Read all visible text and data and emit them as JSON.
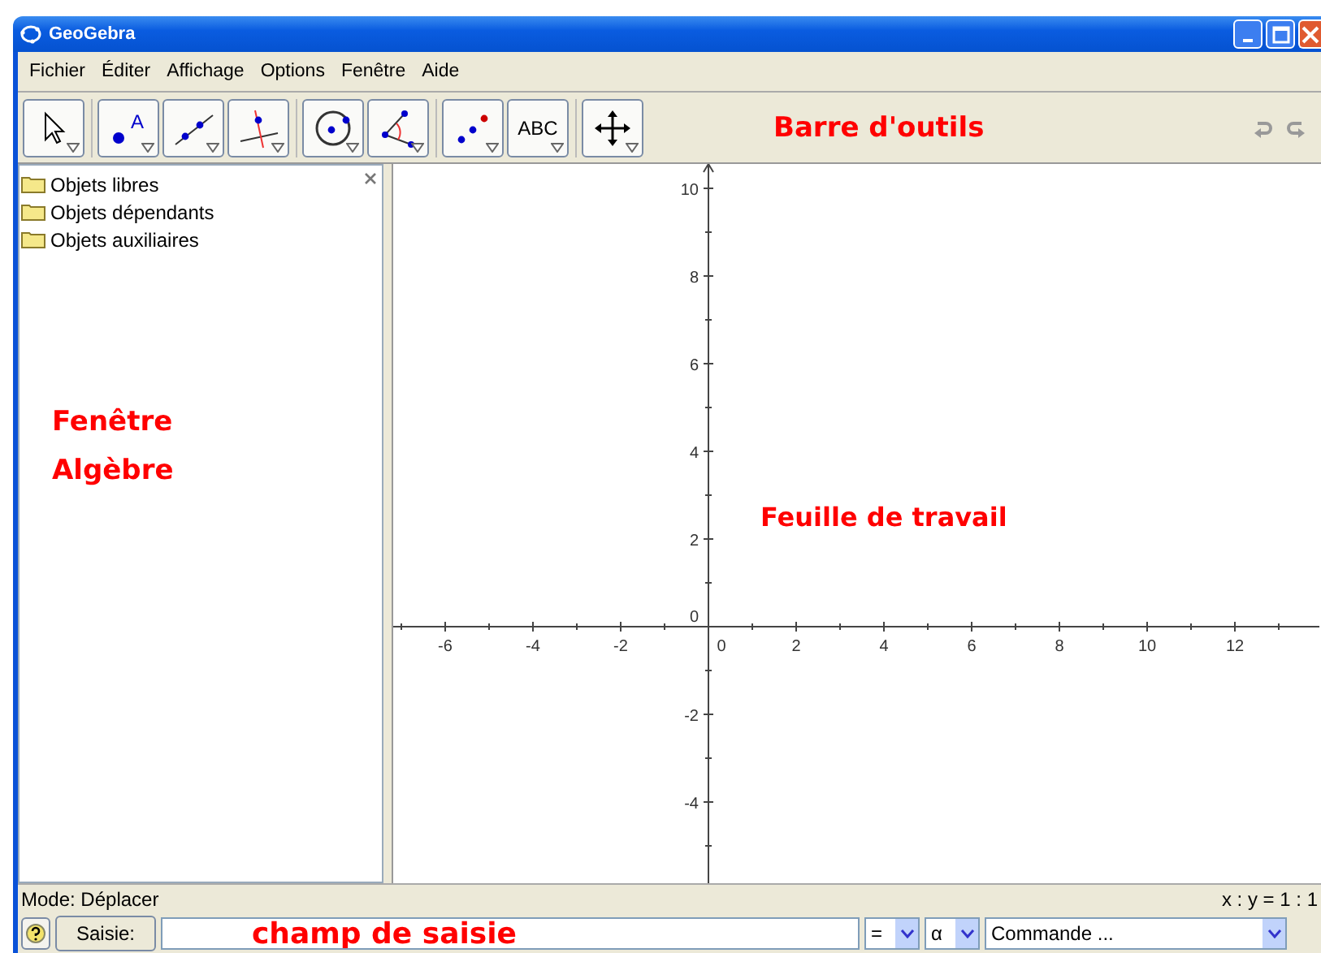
{
  "window": {
    "title": "GeoGebra"
  },
  "menu": [
    "Fichier",
    "Éditer",
    "Affichage",
    "Options",
    "Fenêtre",
    "Aide"
  ],
  "toolbar": {
    "groups": [
      [
        {
          "kind": "move"
        }
      ],
      [
        {
          "kind": "point",
          "label": "A"
        },
        {
          "kind": "line"
        },
        {
          "kind": "perpendicular"
        }
      ],
      [
        {
          "kind": "circle"
        },
        {
          "kind": "angle"
        }
      ],
      [
        {
          "kind": "reflect"
        },
        {
          "kind": "text",
          "label": "ABC"
        }
      ],
      [
        {
          "kind": "pan"
        }
      ]
    ],
    "annotation": "Barre d'outils"
  },
  "algebra": {
    "folders": [
      "Objets libres",
      "Objets dépendants",
      "Objets auxiliaires"
    ],
    "annotation": [
      "Fenêtre",
      "Algèbre"
    ]
  },
  "graphics": {
    "x_labels": [
      "-6",
      "-4",
      "-2",
      "0",
      "2",
      "4",
      "6",
      "8",
      "10",
      "12"
    ],
    "y_labels": [
      "10",
      "8",
      "6",
      "4",
      "2",
      "0",
      "-2",
      "-4"
    ],
    "annotation": "Feuille de travail"
  },
  "status_bar": {
    "mode": "Mode: Déplacer",
    "ratio": "x : y = 1 : 1"
  },
  "input_bar": {
    "button": "Saisie:",
    "annotation": "champ de saisie",
    "dropdowns": [
      "=",
      "α",
      "Commande ..."
    ]
  }
}
